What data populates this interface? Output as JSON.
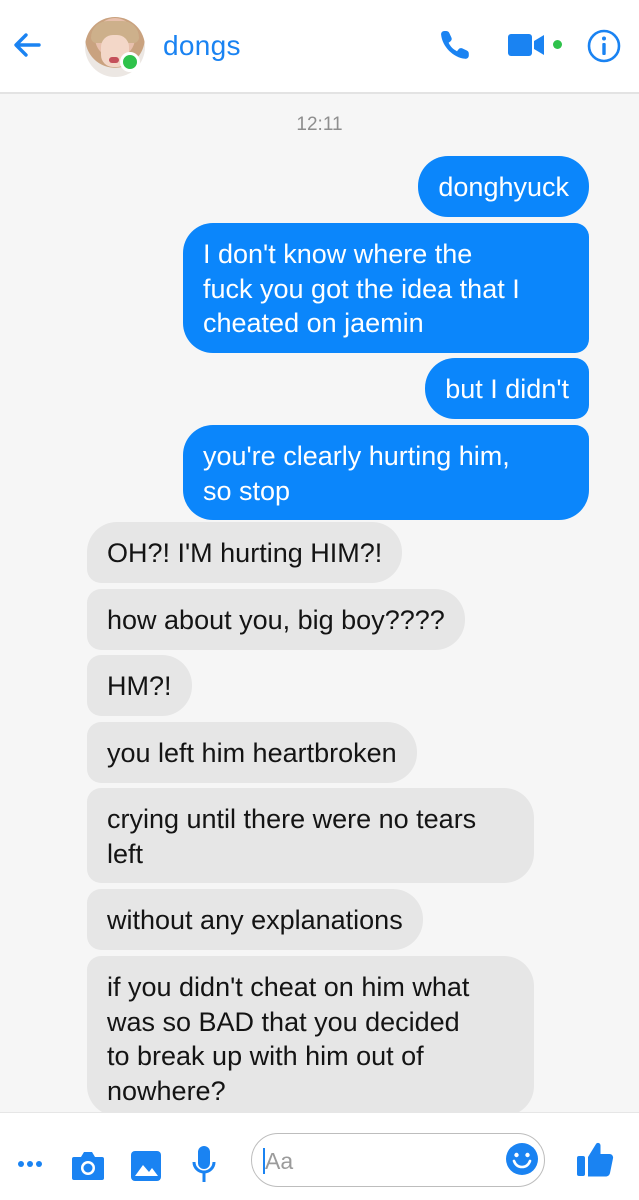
{
  "header": {
    "title": "dongs",
    "accent": "#1a83f2",
    "online": true,
    "icons": [
      "back-arrow-icon",
      "phone-icon",
      "video-call-icon",
      "info-icon"
    ]
  },
  "timestamp": "12:11",
  "messages": [
    {
      "side": "out",
      "text": "donghyuck"
    },
    {
      "side": "out",
      "text": "I don't know where the\nfuck you got the idea that I\ncheated on jaemin"
    },
    {
      "side": "out",
      "text": "but I didn't"
    },
    {
      "side": "out",
      "text": "you're clearly hurting him,\nso stop"
    },
    {
      "side": "in",
      "text": "OH?! I'M hurting HIM?!"
    },
    {
      "side": "in",
      "text": "how about you, big boy????"
    },
    {
      "side": "in",
      "text": "HM?!"
    },
    {
      "side": "in",
      "text": "you left him heartbroken"
    },
    {
      "side": "in",
      "text": "crying until there were no tears\nleft"
    },
    {
      "side": "in",
      "text": "without any explanations"
    },
    {
      "side": "in",
      "text": "if you didn't cheat on him what\nwas so BAD that you decided\nto break up with him out of\nnowhere?"
    }
  ],
  "composer": {
    "placeholder": "Aa",
    "icons": [
      "more-icon",
      "camera-icon",
      "gallery-icon",
      "microphone-icon",
      "emoji-icon",
      "thumbs-up-icon"
    ]
  },
  "colors": {
    "outgoing_bubble": "#0b86fb",
    "incoming_bubble": "#e6e6e6",
    "background": "#f6f6f6"
  }
}
